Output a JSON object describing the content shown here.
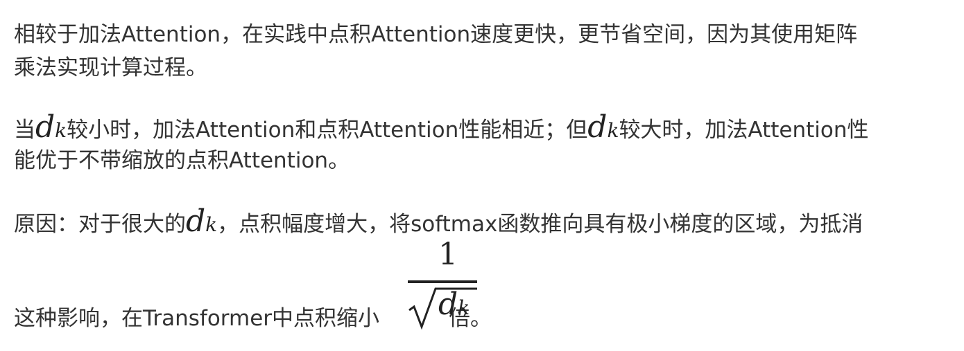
{
  "paragraph1": {
    "line1": "相较于加法Attention，在实践中点积Attention速度更快，更节省空间，因为其使用矩阵",
    "line2": "乘法实现计算过程。"
  },
  "paragraph2": {
    "l1_a": "当",
    "l1_b": "较小时，加法Attention和点积Attention性能相近；但",
    "l1_c": "较大时，加法Attention性",
    "line2": "能优于不带缩放的点积Attention。"
  },
  "paragraph3": {
    "l1_a": "原因：对于很大的",
    "l1_b": "，点积幅度增大，将softmax函数推向具有极小梯度的区域，为抵消",
    "l2_a": "这种影响，在Transformer中点积缩小",
    "l2_b": "倍。"
  },
  "math": {
    "d": "d",
    "k": "k",
    "numerator": "1"
  }
}
